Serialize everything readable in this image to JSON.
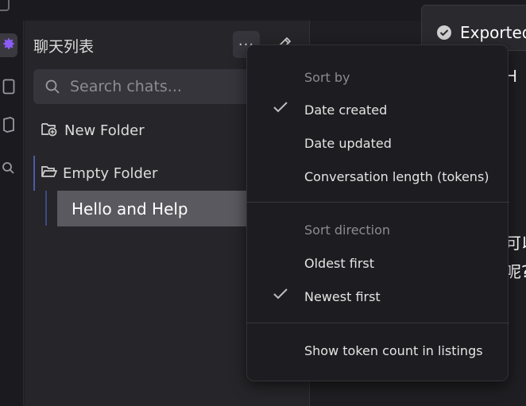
{
  "sidebar": {
    "title": "聊天列表",
    "more_label": "···",
    "search": {
      "placeholder": "Search chats...",
      "value": ""
    },
    "new_folder_label": "New Folder",
    "folders": [
      {
        "label": "Empty Folder",
        "chats": [
          {
            "label": "Hello and Help"
          }
        ]
      }
    ]
  },
  "notice": {
    "text": "Exported"
  },
  "background_fragments": [
    "H",
    "可以",
    "呢?"
  ],
  "sort_menu": {
    "sort_by_label": "Sort by",
    "sort_by_options": [
      {
        "label": "Date created",
        "checked": true
      },
      {
        "label": "Date updated",
        "checked": false
      },
      {
        "label": "Conversation length (tokens)",
        "checked": false
      }
    ],
    "sort_direction_label": "Sort direction",
    "sort_direction_options": [
      {
        "label": "Oldest first",
        "checked": false
      },
      {
        "label": "Newest first",
        "checked": true
      }
    ],
    "show_token_count_label": "Show token count in listings"
  },
  "colors": {
    "background": "#1f1e22",
    "sidebar": "#262529",
    "accent_purple": "#8b5cf6",
    "selected_item": "#5a595f",
    "tree_guide": "#4a5ca8"
  },
  "icons": [
    "gear-icon",
    "file-icon",
    "book-icon",
    "search-file-icon",
    "more-icon",
    "new-chat-icon",
    "search-icon",
    "folder-plus-icon",
    "folder-open-icon",
    "check-circle-icon",
    "checkmark-icon"
  ]
}
